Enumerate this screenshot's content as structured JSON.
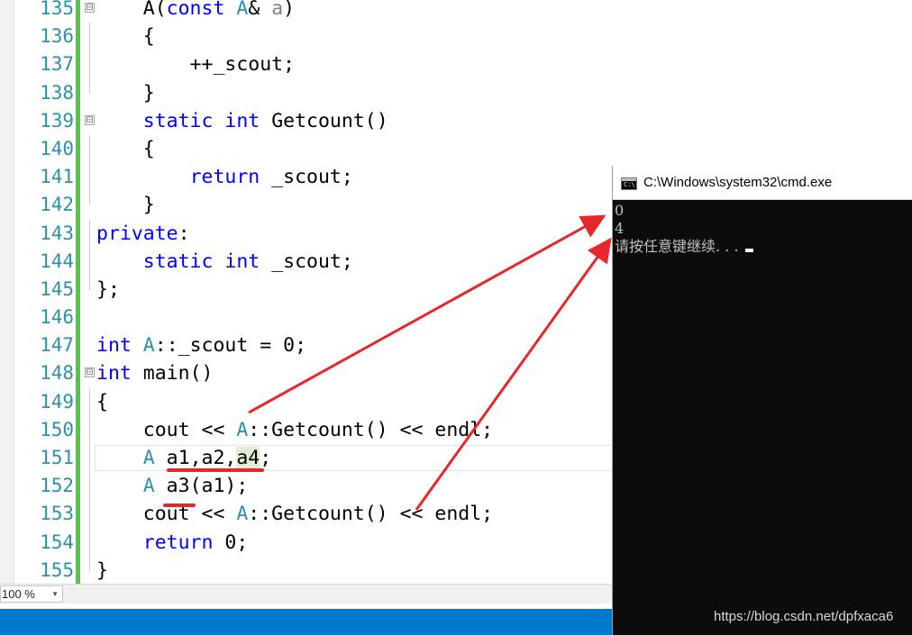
{
  "editor": {
    "zoom": "100 %",
    "lines": [
      {
        "num": "135",
        "fold": "⊟",
        "guide": "none",
        "tokens": [
          {
            "t": "    A(",
            "c": ""
          },
          {
            "t": "const",
            "c": "kw"
          },
          {
            "t": " ",
            "c": ""
          },
          {
            "t": "A",
            "c": "ty"
          },
          {
            "t": "& ",
            "c": ""
          },
          {
            "t": "a",
            "c": "pm"
          },
          {
            "t": ")",
            "c": ""
          }
        ]
      },
      {
        "num": "136",
        "guide": "line",
        "tokens": [
          {
            "t": "    {",
            "c": ""
          }
        ]
      },
      {
        "num": "137",
        "guide": "line",
        "tokens": [
          {
            "t": "        ++_scout;",
            "c": ""
          }
        ]
      },
      {
        "num": "138",
        "guide": "end",
        "tokens": [
          {
            "t": "    }",
            "c": ""
          }
        ]
      },
      {
        "num": "139",
        "fold": "⊟",
        "guide": "none",
        "tokens": [
          {
            "t": "    ",
            "c": ""
          },
          {
            "t": "static",
            "c": "kw"
          },
          {
            "t": " ",
            "c": ""
          },
          {
            "t": "int",
            "c": "kw"
          },
          {
            "t": " Getcount()",
            "c": ""
          }
        ]
      },
      {
        "num": "140",
        "guide": "line",
        "tokens": [
          {
            "t": "    {",
            "c": ""
          }
        ]
      },
      {
        "num": "141",
        "guide": "line",
        "tokens": [
          {
            "t": "        ",
            "c": ""
          },
          {
            "t": "return",
            "c": "kw"
          },
          {
            "t": " _scout;",
            "c": ""
          }
        ]
      },
      {
        "num": "142",
        "guide": "end",
        "tokens": [
          {
            "t": "    }",
            "c": ""
          }
        ]
      },
      {
        "num": "143",
        "guide": "line",
        "tokens": [
          {
            "t": "private",
            "c": "kw"
          },
          {
            "t": ":",
            "c": ""
          }
        ]
      },
      {
        "num": "144",
        "guide": "line",
        "tokens": [
          {
            "t": "    ",
            "c": ""
          },
          {
            "t": "static",
            "c": "kw"
          },
          {
            "t": " ",
            "c": ""
          },
          {
            "t": "int",
            "c": "kw"
          },
          {
            "t": " _scout;",
            "c": ""
          }
        ]
      },
      {
        "num": "145",
        "guide": "end",
        "tokens": [
          {
            "t": "};",
            "c": ""
          }
        ]
      },
      {
        "num": "146",
        "guide": "none",
        "tokens": []
      },
      {
        "num": "147",
        "guide": "none",
        "tokens": [
          {
            "t": "int",
            "c": "kw"
          },
          {
            "t": " ",
            "c": ""
          },
          {
            "t": "A",
            "c": "ty"
          },
          {
            "t": "::_scout = 0;",
            "c": ""
          }
        ]
      },
      {
        "num": "148",
        "fold": "⊟",
        "guide": "none",
        "tokens": [
          {
            "t": "int",
            "c": "kw"
          },
          {
            "t": " main()",
            "c": ""
          }
        ]
      },
      {
        "num": "149",
        "guide": "line",
        "tokens": [
          {
            "t": "{",
            "c": ""
          }
        ]
      },
      {
        "num": "150",
        "guide": "line",
        "tokens": [
          {
            "t": "    cout << ",
            "c": ""
          },
          {
            "t": "A",
            "c": "ty"
          },
          {
            "t": "::Getcount() << endl;",
            "c": ""
          }
        ]
      },
      {
        "num": "151",
        "guide": "line",
        "highlight": true,
        "tokens": [
          {
            "t": "    ",
            "c": ""
          },
          {
            "t": "A",
            "c": "ty"
          },
          {
            "t": " a1,a2,",
            "c": ""
          },
          {
            "t": "a4",
            "c": "sel"
          },
          {
            "t": ";",
            "c": ""
          }
        ]
      },
      {
        "num": "152",
        "guide": "line",
        "tokens": [
          {
            "t": "    ",
            "c": ""
          },
          {
            "t": "A",
            "c": "ty"
          },
          {
            "t": " a3(a1);",
            "c": ""
          }
        ]
      },
      {
        "num": "153",
        "guide": "line",
        "tokens": [
          {
            "t": "    cout << ",
            "c": ""
          },
          {
            "t": "A",
            "c": "ty"
          },
          {
            "t": "::Getcount() << endl;",
            "c": ""
          }
        ]
      },
      {
        "num": "154",
        "guide": "line",
        "tokens": [
          {
            "t": "    ",
            "c": ""
          },
          {
            "t": "return",
            "c": "kw"
          },
          {
            "t": " 0;",
            "c": ""
          }
        ]
      },
      {
        "num": "155",
        "guide": "end",
        "tokens": [
          {
            "t": "}",
            "c": ""
          }
        ]
      }
    ]
  },
  "console": {
    "title": "C:\\Windows\\system32\\cmd.exe",
    "icon": "console-app-icon",
    "icon_text": "C:\\",
    "output": [
      "0",
      "4",
      "请按任意键继续. . . "
    ],
    "watermark": "https://blog.csdn.net/dpfxaca6"
  },
  "colors": {
    "keyword": "#0000ff",
    "type": "#2b91af",
    "annotation": "#e8272a",
    "status_bar": "#007acc"
  }
}
